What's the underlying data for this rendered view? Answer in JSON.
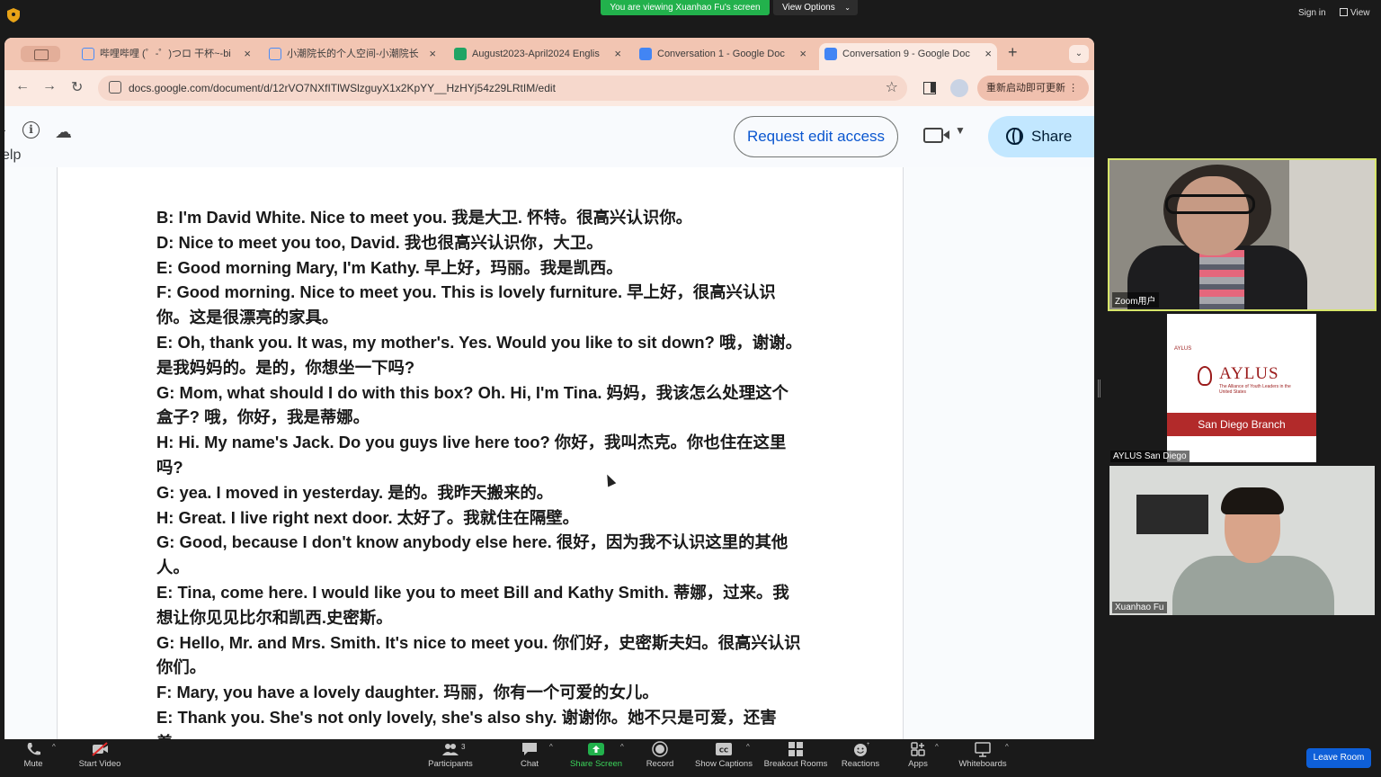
{
  "zoom": {
    "viewing_banner": "You are viewing Xuanhao Fu's screen",
    "view_options": "View Options",
    "sign_in": "Sign in",
    "view": "View",
    "leave_room": "Leave Room"
  },
  "browser": {
    "tabs": [
      {
        "label": "哔哩哔哩 (゜-゜)つロ 干杯~-bi",
        "favicon_color": "#4a8cf7"
      },
      {
        "label": "小潮院长的个人空间-小潮院长",
        "favicon_color": "#4a8cf7"
      },
      {
        "label": "August2023-April2024 Englis",
        "favicon_color": "#21a464"
      },
      {
        "label": "Conversation 1 - Google Doc",
        "favicon_color": "#4285f4"
      },
      {
        "label": "Conversation 9 - Google Doc",
        "favicon_color": "#4285f4"
      }
    ],
    "url": "docs.google.com/document/d/12rVO7NXfITlWSlzguyX1x2KpYY__HzHYj54z29LRtIM/edit",
    "update_button": "重新启动即可更新"
  },
  "docs": {
    "help_partial": "elp",
    "request_edit": "Request edit access",
    "share": "Share",
    "lines": [
      "B: I'm David White. Nice to meet you. 我是大卫. 怀特。很高兴认识你。",
      "D: Nice to meet you too, David. 我也很高兴认识你，大卫。",
      "E: Good morning Mary, I'm Kathy. 早上好，玛丽。我是凯西。",
      "F: Good morning. Nice to meet you. This is lovely furniture. 早上好，很高兴认识你。这是很漂亮的家具。",
      "E: Oh, thank you. It was, my mother's. Yes. Would you like to sit down? 哦，谢谢。是我妈妈的。是的，你想坐一下吗?",
      "G: Mom, what should I do with this box? Oh. Hi, I'm Tina. 妈妈，我该怎么处理这个盒子? 哦，你好，我是蒂娜。",
      "H: Hi. My name's Jack.  Do you guys live here too? 你好，我叫杰克。你也住在这里吗?",
      "G: yea.  I moved in yesterday. 是的。我昨天搬来的。",
      "H: Great. I live right next door. 太好了。我就住在隔壁。",
      "G: Good, because I don't know anybody else here. 很好，因为我不认识这里的其他人。",
      "E: Tina, come here. I would like you to meet Bill and Kathy Smith. 蒂娜，过来。我想让你见见比尔和凯西.史密斯。",
      "G: Hello, Mr. and Mrs. Smith. It's nice to meet you. 你们好，史密斯夫妇。很高兴认识你们。",
      "F: Mary, you have a lovely daughter. 玛丽，你有一个可爱的女儿。",
      "E: Thank you. She's not only lovely, she's also shy. 谢谢你。她不只是可爱，还害羞。"
    ]
  },
  "participants_panel": {
    "tiles": [
      {
        "name": "Zoom用户"
      },
      {
        "name": "AYLUS San Diego"
      },
      {
        "name": "Xuanhao Fu"
      }
    ],
    "aylus_card": {
      "tiny": "AYLUS",
      "logo": "AYLUS",
      "sub": "The Alliance of Youth Leaders in the United States",
      "branch": "San Diego Branch"
    }
  },
  "toolbar": {
    "mute": "Mute",
    "start_video": "Start Video",
    "participants": "Participants",
    "participants_count": "3",
    "chat": "Chat",
    "share_screen": "Share Screen",
    "record": "Record",
    "show_captions": "Show Captions",
    "breakout_rooms": "Breakout Rooms",
    "reactions": "Reactions",
    "apps": "Apps",
    "whiteboards": "Whiteboards"
  },
  "colors": {
    "accent_green": "#22b14c",
    "zoom_blue": "#0e5fd8",
    "docs_blue": "#0b57d0",
    "tab_strip": "#f2c5b2",
    "active_speaker": "#d7e66a"
  }
}
